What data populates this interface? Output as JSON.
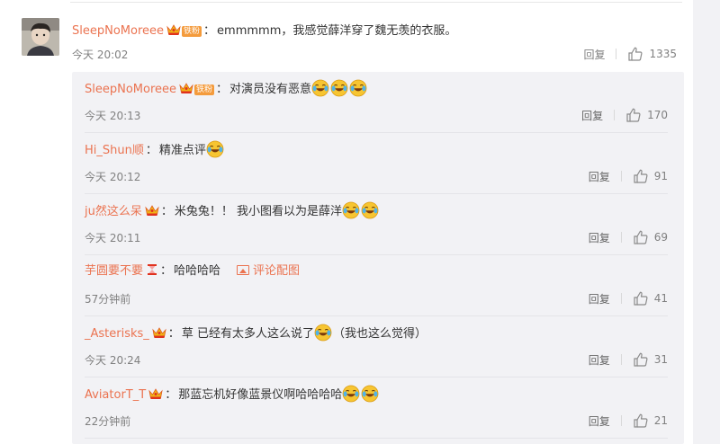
{
  "main_comment": {
    "username": "SleepNoMoreee",
    "fan_tag": "铁粉",
    "content": "emmmmm，我感觉薛洋穿了魏无羡的衣服。",
    "time": "今天 20:02",
    "reply_label": "回复",
    "likes": "1335"
  },
  "replies": [
    {
      "username": "SleepNoMoreee",
      "fan_tag": "铁粉",
      "content": "对演员没有恶意",
      "time": "今天 20:13",
      "reply_label": "回复",
      "likes": "170"
    },
    {
      "username": "Hi_Shun顺",
      "content": "精准点评",
      "time": "今天 20:12",
      "reply_label": "回复",
      "likes": "91"
    },
    {
      "username": "ju然这么呆",
      "content": "米兔兔！！ 我小图看以为是薛洋",
      "time": "今天 20:11",
      "reply_label": "回复",
      "likes": "69"
    },
    {
      "username": "芋圆要不要",
      "content": "哈哈哈哈",
      "pic_link": "评论配图",
      "time": "57分钟前",
      "reply_label": "回复",
      "likes": "41"
    },
    {
      "username": "_Asterisks_",
      "content": "草 已经有太多人这么说了",
      "content_after": "（我也这么觉得）",
      "time": "今天 20:24",
      "reply_label": "回复",
      "likes": "31"
    },
    {
      "username": "AviatorT_T",
      "content": "那蓝忘机好像蓝景仪啊哈哈哈哈",
      "time": "22分钟前",
      "reply_label": "回复",
      "likes": "21"
    }
  ],
  "icons": {
    "like": "thumbs-up-icon",
    "crown": "crown-badge-icon",
    "laugh_emoji": "laugh-cry-emoji-icon",
    "picture": "picture-icon",
    "hourglass": "hourglass-icon"
  },
  "colors": {
    "username": "#eb7350",
    "reply_bg": "#f2f2f5",
    "meta": "#808080",
    "fan_tag": "#f49b3c"
  }
}
